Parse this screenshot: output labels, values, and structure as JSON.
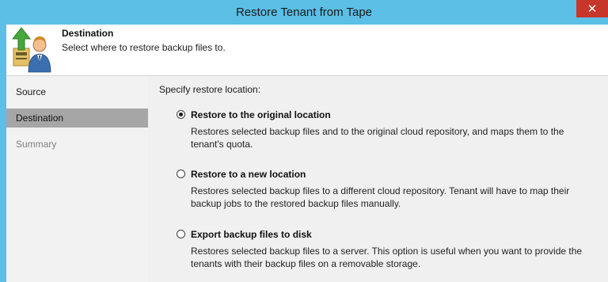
{
  "window": {
    "title": "Restore Tenant from Tape",
    "close_glyph": "✕"
  },
  "header": {
    "title": "Destination",
    "subtitle": "Select where to restore backup files to.",
    "icon": "restore-tenant-icon"
  },
  "nav": {
    "items": [
      {
        "label": "Source",
        "state": "normal"
      },
      {
        "label": "Destination",
        "state": "active"
      },
      {
        "label": "Summary",
        "state": "disabled"
      }
    ]
  },
  "main": {
    "prompt": "Specify restore location:",
    "options": [
      {
        "label": "Restore to the original location",
        "description": "Restores selected backup files and to the original cloud repository, and maps them to the tenant's quota.",
        "selected": true
      },
      {
        "label": "Restore to a new location",
        "description": "Restores selected backup files to a different cloud repository. Tenant will have to map their backup jobs to the restored backup files manually.",
        "selected": false
      },
      {
        "label": "Export backup files to disk",
        "description": "Restores selected backup files to a server. This option is useful when you want to provide the tenants with their backup files on a removable storage.",
        "selected": false
      }
    ]
  },
  "colors": {
    "titlebar": "#5bbfe6",
    "close_button": "#c7362b",
    "nav_active": "#a6a6a6",
    "content_bg": "#f0f0f0",
    "nav_bg": "#f2f2f2"
  }
}
